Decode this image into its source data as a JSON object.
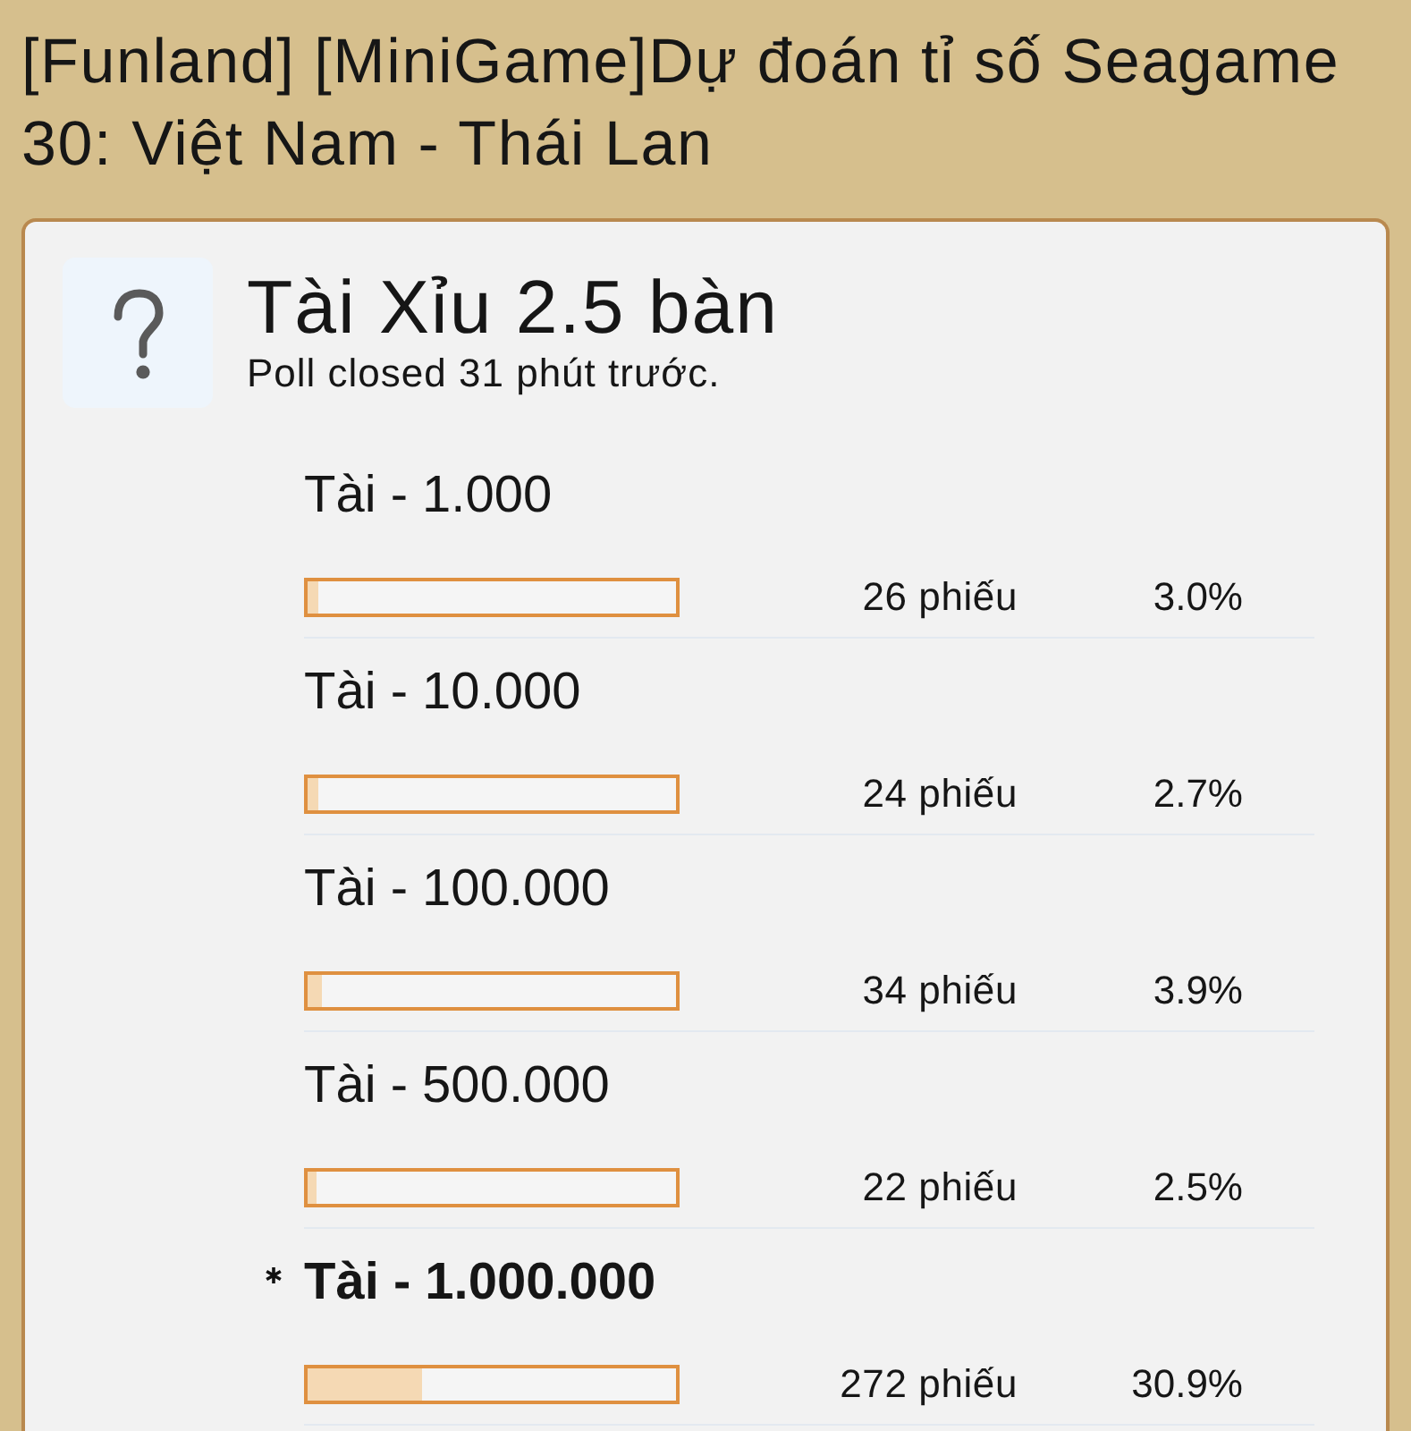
{
  "thread_title": "[Funland] [MiniGame]Dự đoán tỉ số Seagame 30: Việt Nam - Thái Lan",
  "poll": {
    "question": "Tài Xỉu 2.5 bàn",
    "status": "Poll closed 31 phút trước.",
    "options": [
      {
        "label": "Tài - 1.000",
        "votes": "26 phiếu",
        "percent": "3.0%",
        "level": 0.03,
        "selected": false
      },
      {
        "label": "Tài - 10.000",
        "votes": "24 phiếu",
        "percent": "2.7%",
        "level": 0.027,
        "selected": false
      },
      {
        "label": "Tài - 100.000",
        "votes": "34 phiếu",
        "percent": "3.9%",
        "level": 0.039,
        "selected": false
      },
      {
        "label": "Tài - 500.000",
        "votes": "22 phiếu",
        "percent": "2.5%",
        "level": 0.025,
        "selected": false
      },
      {
        "label": "Tài - 1.000.000",
        "votes": "272 phiếu",
        "percent": "30.9%",
        "level": 0.309,
        "selected": true
      }
    ]
  }
}
